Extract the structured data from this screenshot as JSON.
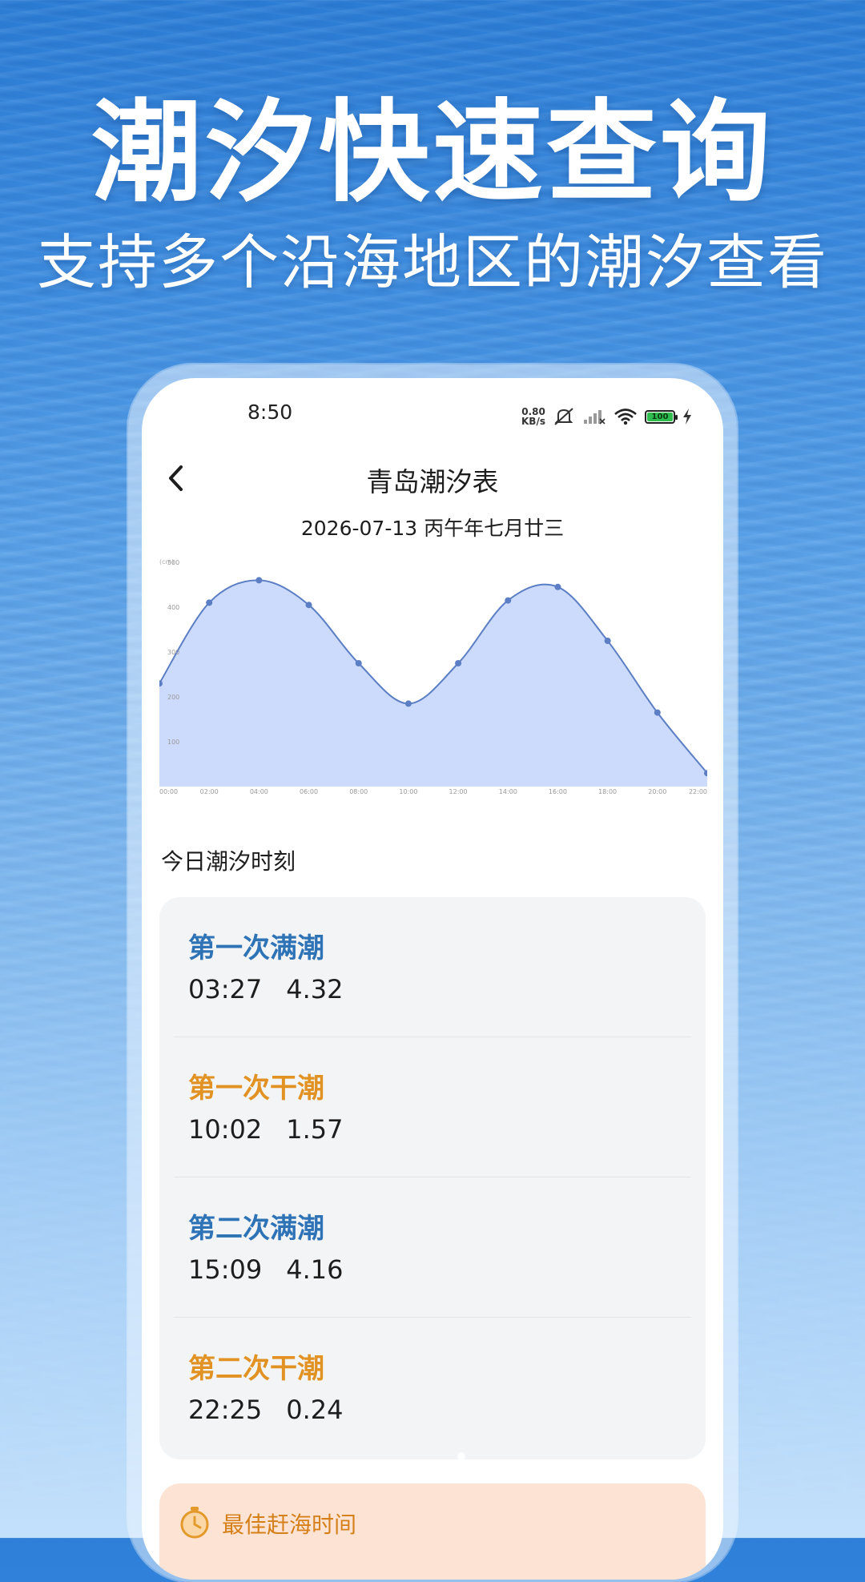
{
  "banner": {
    "headline": "潮汐快速查询",
    "subhead": "支持多个沿海地区的潮汐查看"
  },
  "status_bar": {
    "time": "8:50",
    "net_speed_value": "0.80",
    "net_speed_unit": "KB/s",
    "battery": "100",
    "icons": [
      "mute-icon",
      "signal-icon",
      "wifi-icon",
      "battery-icon",
      "charging-icon"
    ]
  },
  "nav": {
    "title": "青岛潮汐表",
    "back_icon": "chevron-left-icon"
  },
  "date_line": "2026-07-13 丙午年七月廿三",
  "chart_data": {
    "type": "area",
    "ylabel": "(cm)",
    "ylim": [
      0,
      500
    ],
    "yticks": [
      "100",
      "200",
      "300",
      "400",
      "500"
    ],
    "xlim": [
      0,
      22
    ],
    "xticks": [
      "00:00",
      "02:00",
      "04:00",
      "06:00",
      "08:00",
      "10:00",
      "12:00",
      "14:00",
      "16:00",
      "18:00",
      "20:00",
      "22:00"
    ],
    "series": [
      {
        "x": [
          0,
          2,
          4,
          6,
          8,
          10,
          12,
          14,
          16,
          18,
          20,
          22
        ],
        "values": [
          230,
          410,
          460,
          405,
          275,
          185,
          275,
          415,
          445,
          325,
          165,
          30
        ]
      }
    ],
    "colors": {
      "fill": "#c9d8fb",
      "line": "#5b7ec4",
      "point": "#5b7ec4"
    }
  },
  "tides": {
    "section_title": "今日潮汐时刻",
    "items": [
      {
        "label": "第一次满潮",
        "time": "03:27",
        "height": "4.32",
        "kind": "high"
      },
      {
        "label": "第一次干潮",
        "time": "10:02",
        "height": "1.57",
        "kind": "low"
      },
      {
        "label": "第二次满潮",
        "time": "15:09",
        "height": "4.16",
        "kind": "high"
      },
      {
        "label": "第二次干潮",
        "time": "22:25",
        "height": "0.24",
        "kind": "low"
      }
    ]
  },
  "best_time": {
    "label": "最佳赶海时间",
    "icon": "clock-icon"
  },
  "colors": {
    "high": "#2f73b7",
    "low": "#e19222",
    "best_bg": "#fde3d3",
    "card_bg": "#f2f4f6"
  }
}
